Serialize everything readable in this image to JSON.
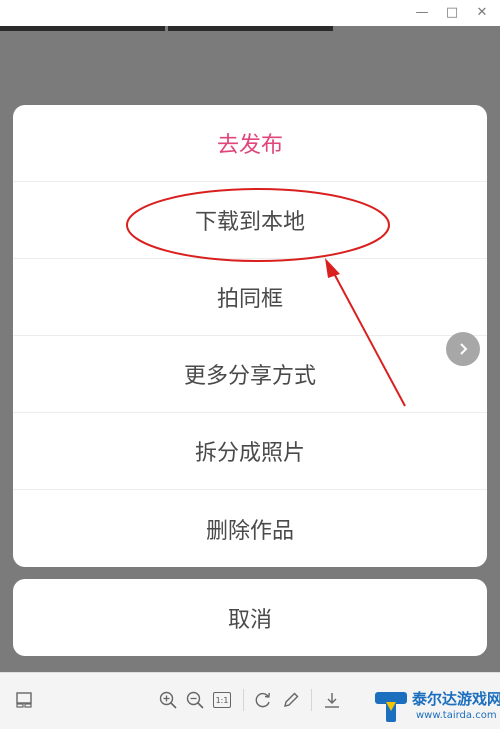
{
  "window": {
    "minimize_glyph": "—",
    "maximize_glyph": "□",
    "close_glyph": "✕"
  },
  "sheet": {
    "items": [
      {
        "label": "去发布"
      },
      {
        "label": "下载到本地"
      },
      {
        "label": "拍同框"
      },
      {
        "label": "更多分享方式"
      },
      {
        "label": "拆分成照片"
      },
      {
        "label": "删除作品"
      }
    ],
    "accent_color": "#e0457b",
    "cancel_label": "取消"
  },
  "annotation": {
    "color": "#d9201f"
  },
  "toolbar": {
    "icons": [
      "gallery-icon",
      "zoom-in-icon",
      "zoom-out-icon",
      "actual-size-icon",
      "rotate-icon",
      "edit-icon",
      "download-icon"
    ],
    "actual_size_label": "1:1"
  },
  "watermark": {
    "title": "泰尔达游戏网",
    "url": "www.tairda.com"
  }
}
